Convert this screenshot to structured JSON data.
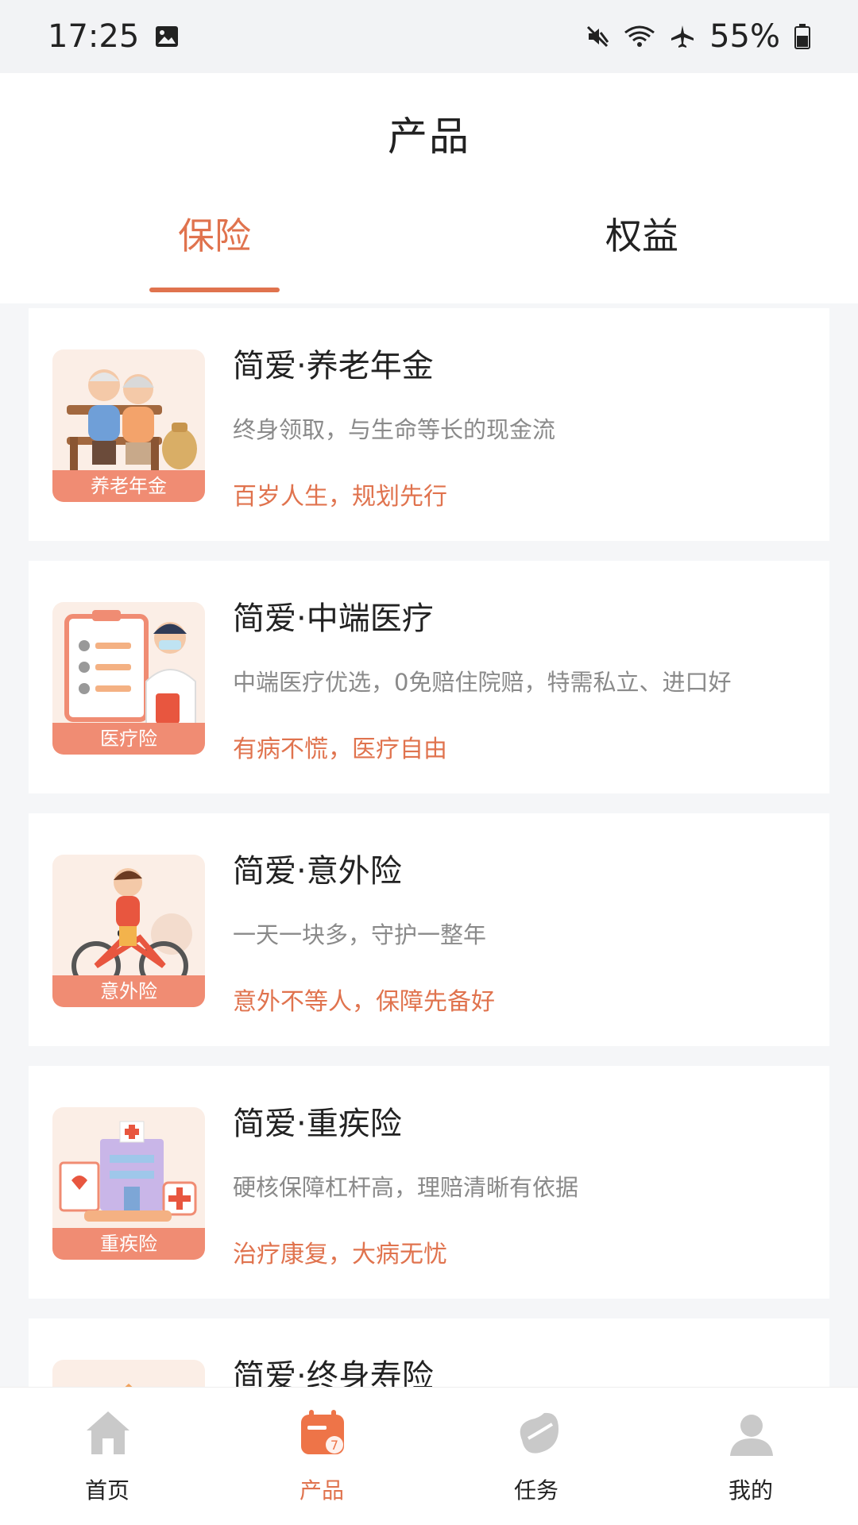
{
  "status_bar": {
    "time": "17:25",
    "battery": "55%",
    "icons": [
      "image-icon",
      "mute-icon",
      "wifi-icon",
      "airplane-icon",
      "battery-icon"
    ]
  },
  "header": {
    "title": "产品"
  },
  "tabs": [
    {
      "label": "保险",
      "active": true
    },
    {
      "label": "权益",
      "active": false
    }
  ],
  "products": [
    {
      "title": "简爱·养老年金",
      "description": "终身领取，与生命等长的现金流",
      "slogan": "百岁人生，规划先行",
      "badge": "养老年金",
      "image": "elderly-couple-image"
    },
    {
      "title": "简爱·中端医疗",
      "description": "中端医疗优选，0免赔住院赔，特需私立、进口好",
      "slogan": "有病不慌，医疗自由",
      "badge": "医疗险",
      "image": "doctor-image"
    },
    {
      "title": "简爱·意外险",
      "description": "一天一块多，守护一整年",
      "slogan": "意外不等人，保障先备好",
      "badge": "意外险",
      "image": "child-bicycle-image"
    },
    {
      "title": "简爱·重疾险",
      "description": "硬核保障杠杆高，理赔清晰有依据",
      "slogan": "治疗康复，大病无忧",
      "badge": "重疾险",
      "image": "hospital-image"
    },
    {
      "title": "简爱·终身寿险",
      "description": "",
      "slogan": "",
      "badge": "",
      "image": "house-image"
    }
  ],
  "bottom_nav": [
    {
      "label": "首页",
      "icon": "home-icon",
      "active": false
    },
    {
      "label": "产品",
      "icon": "calendar-icon",
      "active": true
    },
    {
      "label": "任务",
      "icon": "bean-icon",
      "active": false
    },
    {
      "label": "我的",
      "icon": "user-icon",
      "active": false
    }
  ],
  "colors": {
    "accent": "#e0734e",
    "badge": "#f08c73",
    "background": "#f5f6f8"
  }
}
